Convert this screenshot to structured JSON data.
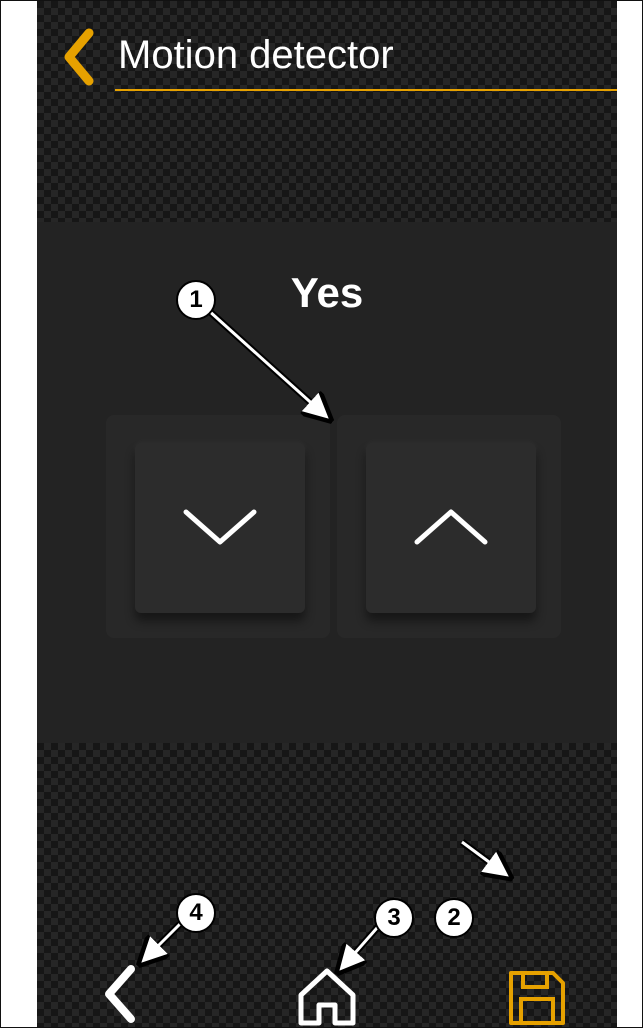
{
  "header": {
    "title": "Motion detector",
    "back_icon": "chevron-left-icon",
    "accent_color": "#e6a100"
  },
  "setting": {
    "value": "Yes",
    "decrease_icon": "chevron-down-icon",
    "increase_icon": "chevron-up-icon"
  },
  "footer": {
    "back_icon": "chevron-left-icon",
    "home_icon": "home-icon",
    "save_icon": "floppy-disk-icon"
  },
  "annotations": [
    {
      "number": "1",
      "target": "increase-button"
    },
    {
      "number": "2",
      "target": "save-button"
    },
    {
      "number": "3",
      "target": "home-button"
    },
    {
      "number": "4",
      "target": "back-button"
    }
  ]
}
